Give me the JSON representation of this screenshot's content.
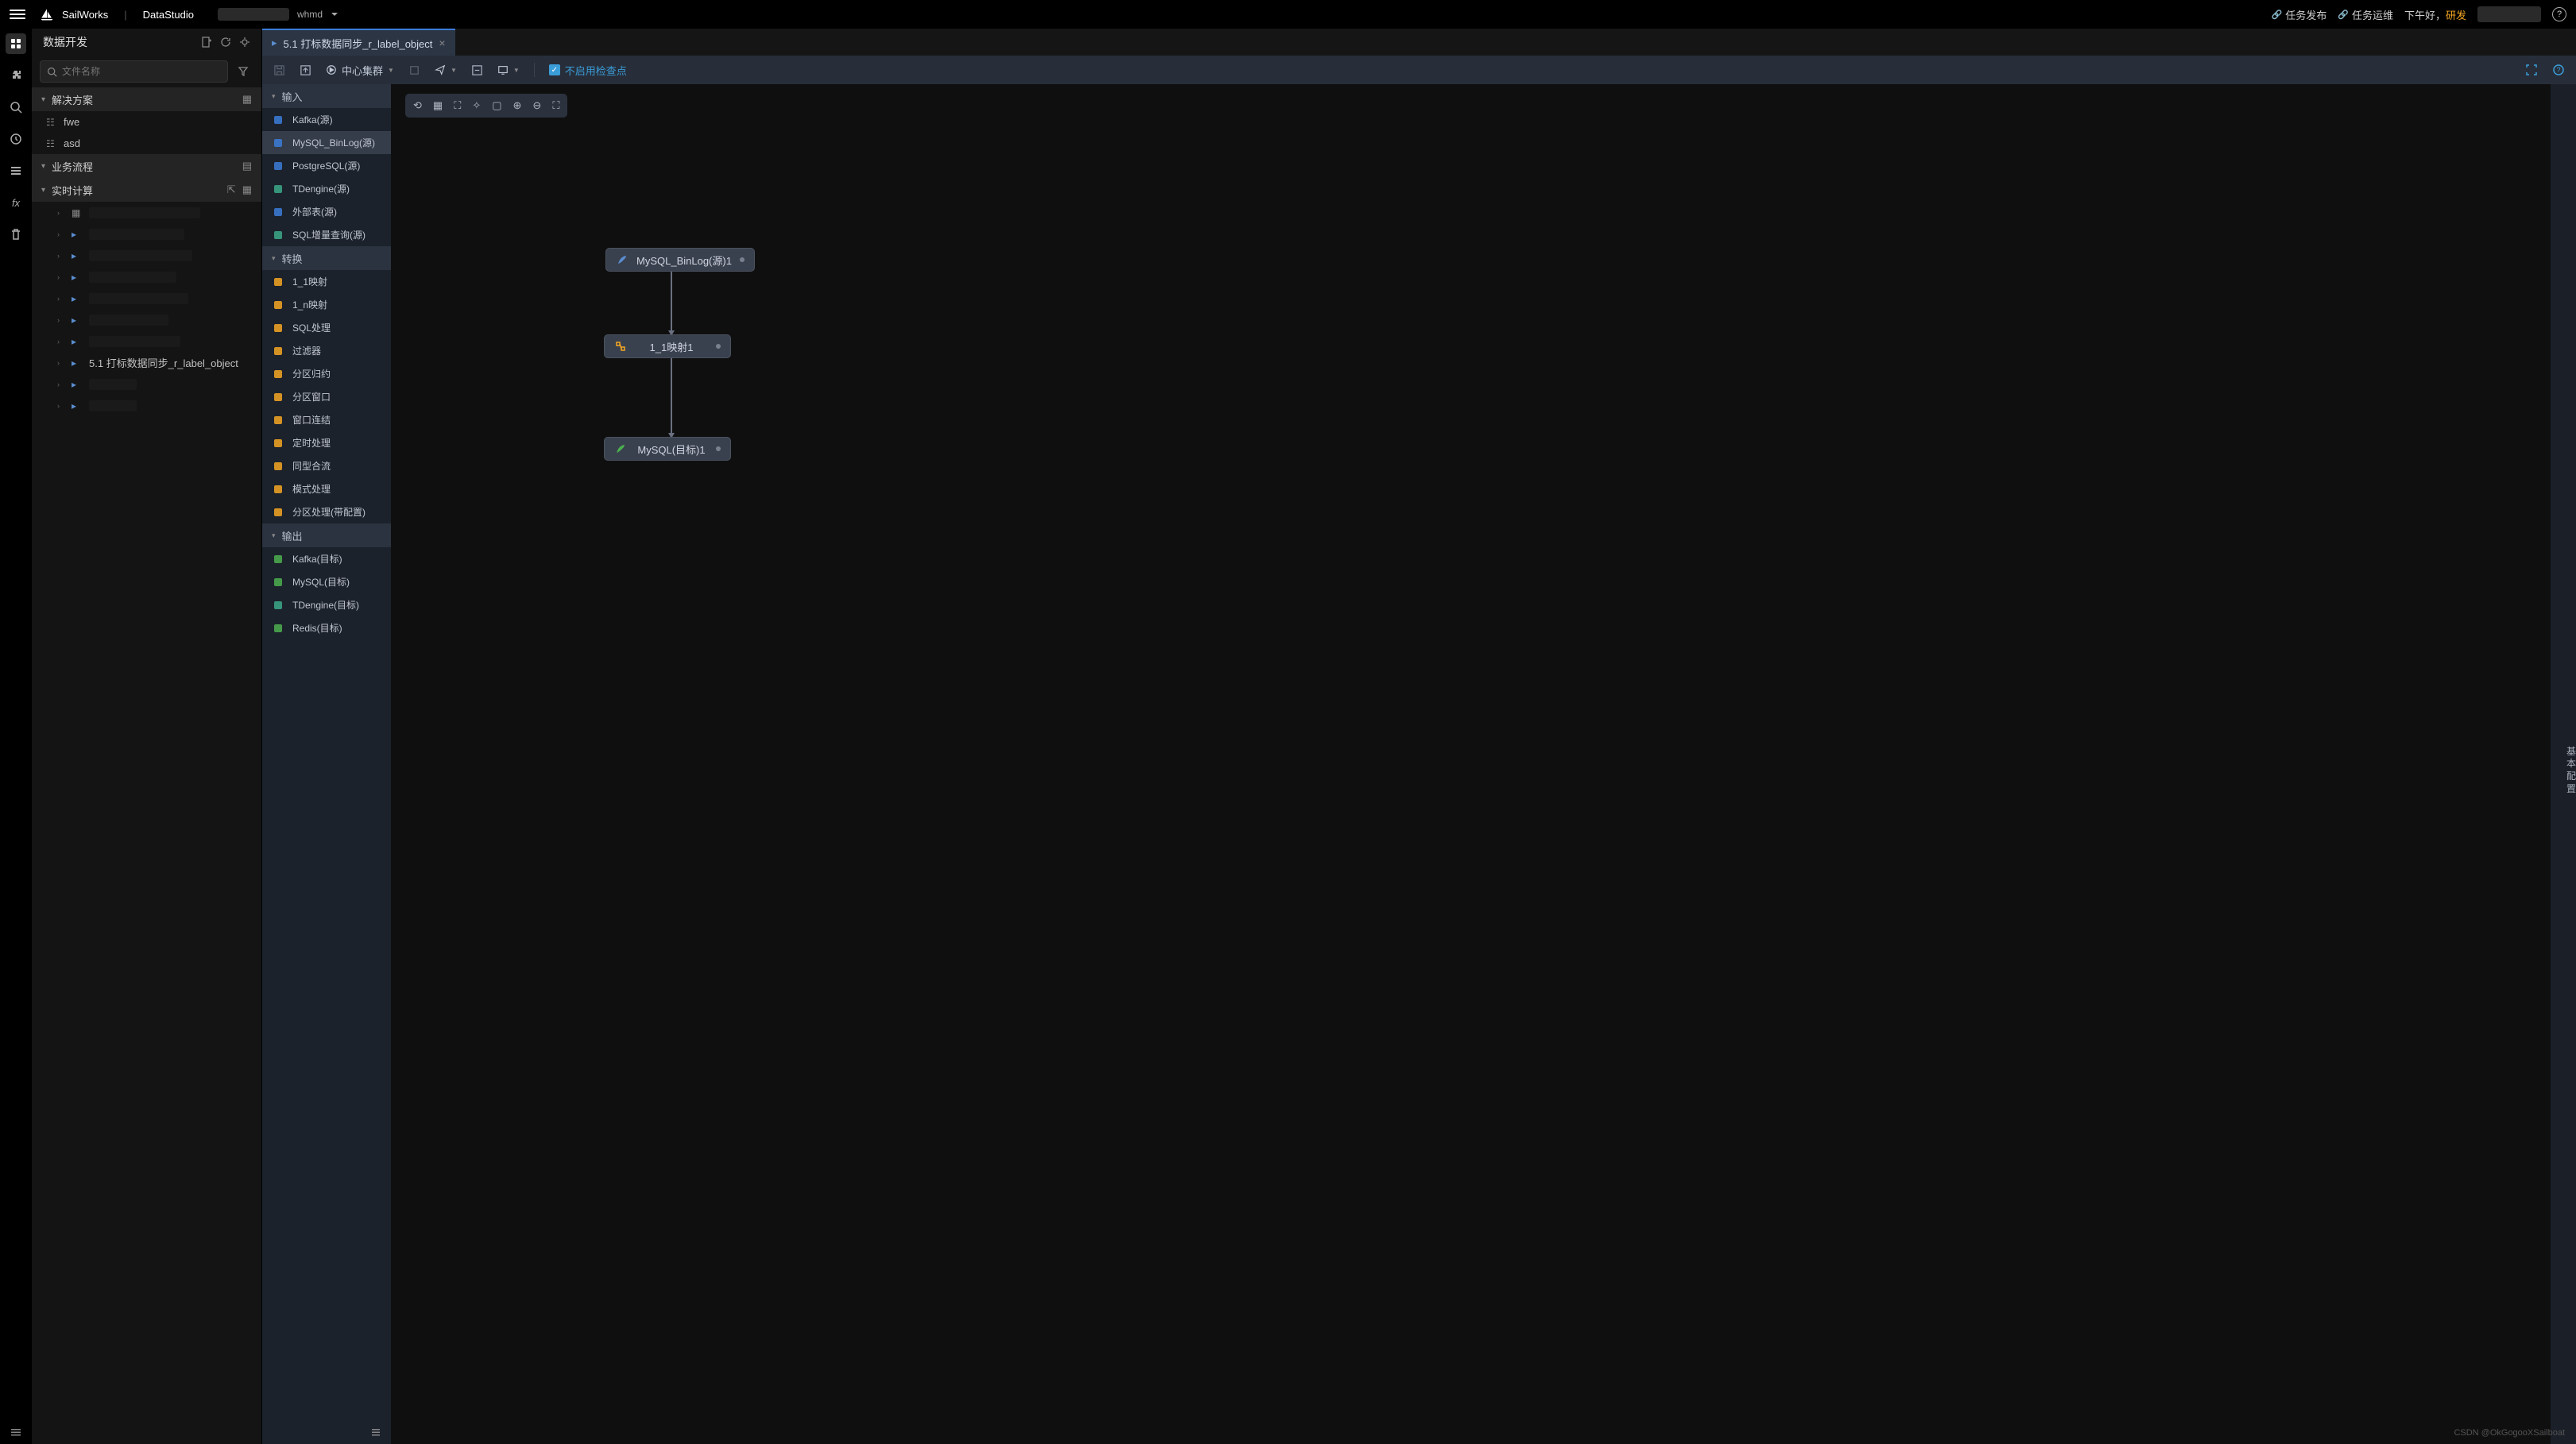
{
  "header": {
    "brand1": "SailWorks",
    "brand2": "DataStudio",
    "workspace": "whmd",
    "link1": "任务发布",
    "link2": "任务运维",
    "greeting_prefix": "下午好，",
    "greeting_name": "研发",
    "help": "?"
  },
  "sidebar": {
    "title": "数据开发",
    "search_placeholder": "文件名称",
    "sections": {
      "solution": "解决方案",
      "workflow": "业务流程",
      "realtime": "实时计算"
    },
    "solution_items": [
      "fwe",
      "asd"
    ],
    "realtime_file": "5.1 打标数据同步_r_label_object"
  },
  "tab": {
    "title": "5.1 打标数据同步_r_label_object"
  },
  "toolbar": {
    "cluster": "中心集群",
    "checkpoint": "不启用检查点"
  },
  "palette": {
    "group_input": "输入",
    "group_transform": "转换",
    "group_output": "输出",
    "input_items": [
      {
        "label": "Kafka(源)",
        "color": "#3b7dd8"
      },
      {
        "label": "MySQL_BinLog(源)",
        "color": "#3b7dd8",
        "selected": true
      },
      {
        "label": "PostgreSQL(源)",
        "color": "#3b7dd8"
      },
      {
        "label": "TDengine(源)",
        "color": "#3ba88a"
      },
      {
        "label": "外部表(源)",
        "color": "#3b7dd8"
      },
      {
        "label": "SQL增量查询(源)",
        "color": "#3ba88a"
      }
    ],
    "transform_items": [
      {
        "label": "1_1映射",
        "color": "#f5a623"
      },
      {
        "label": "1_n映射",
        "color": "#f5a623"
      },
      {
        "label": "SQL处理",
        "color": "#f5a623"
      },
      {
        "label": "过滤器",
        "color": "#f5a623"
      },
      {
        "label": "分区归约",
        "color": "#f5a623"
      },
      {
        "label": "分区窗口",
        "color": "#f5a623"
      },
      {
        "label": "窗口连结",
        "color": "#f5a623"
      },
      {
        "label": "定时处理",
        "color": "#f5a623"
      },
      {
        "label": "同型合流",
        "color": "#f5a623"
      },
      {
        "label": "模式处理",
        "color": "#f5a623"
      },
      {
        "label": "分区处理(带配置)",
        "color": "#f5a623"
      }
    ],
    "output_items": [
      {
        "label": "Kafka(目标)",
        "color": "#4caf50"
      },
      {
        "label": "MySQL(目标)",
        "color": "#4caf50"
      },
      {
        "label": "TDengine(目标)",
        "color": "#3ba88a"
      },
      {
        "label": "Redis(目标)",
        "color": "#4caf50"
      }
    ]
  },
  "nodes": {
    "n1": "MySQL_BinLog(源)1",
    "n2": "1_1映射1",
    "n3": "MySQL(目标)1"
  },
  "right_rail": "基本配置",
  "watermark": "CSDN @OkGogooXSailboat"
}
